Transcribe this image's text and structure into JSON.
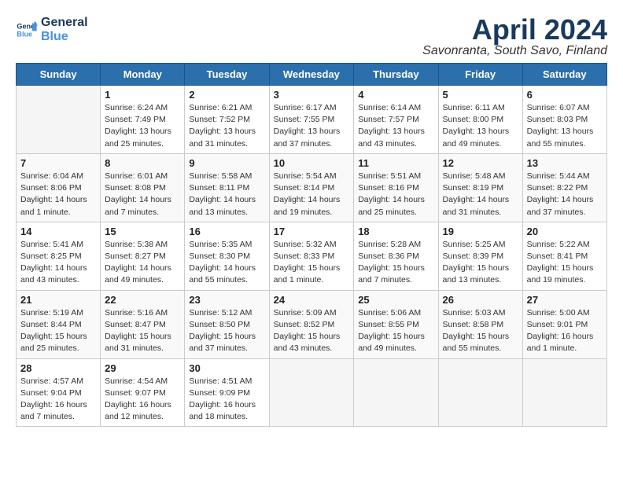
{
  "logo": {
    "line1": "General",
    "line2": "Blue"
  },
  "title": "April 2024",
  "subtitle": "Savonranta, South Savo, Finland",
  "weekdays": [
    "Sunday",
    "Monday",
    "Tuesday",
    "Wednesday",
    "Thursday",
    "Friday",
    "Saturday"
  ],
  "weeks": [
    [
      {
        "day": "",
        "info": ""
      },
      {
        "day": "1",
        "info": "Sunrise: 6:24 AM\nSunset: 7:49 PM\nDaylight: 13 hours\nand 25 minutes."
      },
      {
        "day": "2",
        "info": "Sunrise: 6:21 AM\nSunset: 7:52 PM\nDaylight: 13 hours\nand 31 minutes."
      },
      {
        "day": "3",
        "info": "Sunrise: 6:17 AM\nSunset: 7:55 PM\nDaylight: 13 hours\nand 37 minutes."
      },
      {
        "day": "4",
        "info": "Sunrise: 6:14 AM\nSunset: 7:57 PM\nDaylight: 13 hours\nand 43 minutes."
      },
      {
        "day": "5",
        "info": "Sunrise: 6:11 AM\nSunset: 8:00 PM\nDaylight: 13 hours\nand 49 minutes."
      },
      {
        "day": "6",
        "info": "Sunrise: 6:07 AM\nSunset: 8:03 PM\nDaylight: 13 hours\nand 55 minutes."
      }
    ],
    [
      {
        "day": "7",
        "info": "Sunrise: 6:04 AM\nSunset: 8:06 PM\nDaylight: 14 hours\nand 1 minute."
      },
      {
        "day": "8",
        "info": "Sunrise: 6:01 AM\nSunset: 8:08 PM\nDaylight: 14 hours\nand 7 minutes."
      },
      {
        "day": "9",
        "info": "Sunrise: 5:58 AM\nSunset: 8:11 PM\nDaylight: 14 hours\nand 13 minutes."
      },
      {
        "day": "10",
        "info": "Sunrise: 5:54 AM\nSunset: 8:14 PM\nDaylight: 14 hours\nand 19 minutes."
      },
      {
        "day": "11",
        "info": "Sunrise: 5:51 AM\nSunset: 8:16 PM\nDaylight: 14 hours\nand 25 minutes."
      },
      {
        "day": "12",
        "info": "Sunrise: 5:48 AM\nSunset: 8:19 PM\nDaylight: 14 hours\nand 31 minutes."
      },
      {
        "day": "13",
        "info": "Sunrise: 5:44 AM\nSunset: 8:22 PM\nDaylight: 14 hours\nand 37 minutes."
      }
    ],
    [
      {
        "day": "14",
        "info": "Sunrise: 5:41 AM\nSunset: 8:25 PM\nDaylight: 14 hours\nand 43 minutes."
      },
      {
        "day": "15",
        "info": "Sunrise: 5:38 AM\nSunset: 8:27 PM\nDaylight: 14 hours\nand 49 minutes."
      },
      {
        "day": "16",
        "info": "Sunrise: 5:35 AM\nSunset: 8:30 PM\nDaylight: 14 hours\nand 55 minutes."
      },
      {
        "day": "17",
        "info": "Sunrise: 5:32 AM\nSunset: 8:33 PM\nDaylight: 15 hours\nand 1 minute."
      },
      {
        "day": "18",
        "info": "Sunrise: 5:28 AM\nSunset: 8:36 PM\nDaylight: 15 hours\nand 7 minutes."
      },
      {
        "day": "19",
        "info": "Sunrise: 5:25 AM\nSunset: 8:39 PM\nDaylight: 15 hours\nand 13 minutes."
      },
      {
        "day": "20",
        "info": "Sunrise: 5:22 AM\nSunset: 8:41 PM\nDaylight: 15 hours\nand 19 minutes."
      }
    ],
    [
      {
        "day": "21",
        "info": "Sunrise: 5:19 AM\nSunset: 8:44 PM\nDaylight: 15 hours\nand 25 minutes."
      },
      {
        "day": "22",
        "info": "Sunrise: 5:16 AM\nSunset: 8:47 PM\nDaylight: 15 hours\nand 31 minutes."
      },
      {
        "day": "23",
        "info": "Sunrise: 5:12 AM\nSunset: 8:50 PM\nDaylight: 15 hours\nand 37 minutes."
      },
      {
        "day": "24",
        "info": "Sunrise: 5:09 AM\nSunset: 8:52 PM\nDaylight: 15 hours\nand 43 minutes."
      },
      {
        "day": "25",
        "info": "Sunrise: 5:06 AM\nSunset: 8:55 PM\nDaylight: 15 hours\nand 49 minutes."
      },
      {
        "day": "26",
        "info": "Sunrise: 5:03 AM\nSunset: 8:58 PM\nDaylight: 15 hours\nand 55 minutes."
      },
      {
        "day": "27",
        "info": "Sunrise: 5:00 AM\nSunset: 9:01 PM\nDaylight: 16 hours\nand 1 minute."
      }
    ],
    [
      {
        "day": "28",
        "info": "Sunrise: 4:57 AM\nSunset: 9:04 PM\nDaylight: 16 hours\nand 7 minutes."
      },
      {
        "day": "29",
        "info": "Sunrise: 4:54 AM\nSunset: 9:07 PM\nDaylight: 16 hours\nand 12 minutes."
      },
      {
        "day": "30",
        "info": "Sunrise: 4:51 AM\nSunset: 9:09 PM\nDaylight: 16 hours\nand 18 minutes."
      },
      {
        "day": "",
        "info": ""
      },
      {
        "day": "",
        "info": ""
      },
      {
        "day": "",
        "info": ""
      },
      {
        "day": "",
        "info": ""
      }
    ]
  ]
}
